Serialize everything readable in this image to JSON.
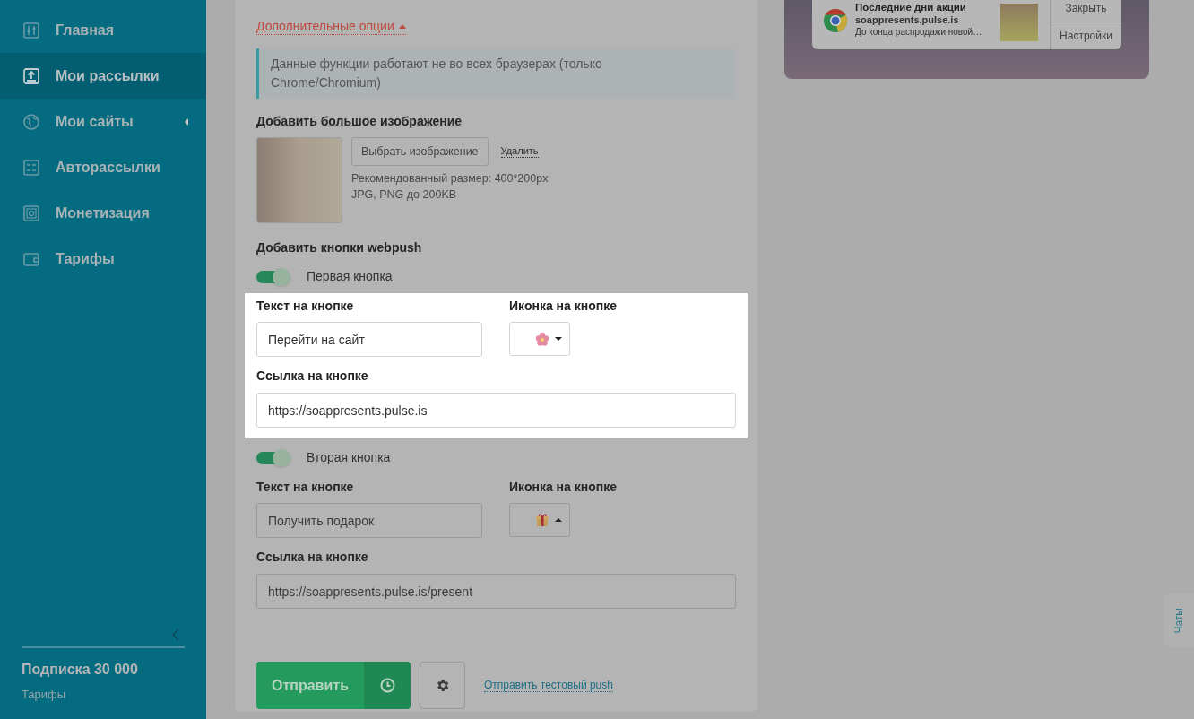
{
  "sidebar": {
    "items": [
      {
        "label": "Главная",
        "selected": false,
        "has_submenu": false,
        "kind": "sliders"
      },
      {
        "label": "Мои рассылки",
        "selected": true,
        "has_submenu": false,
        "kind": "upload"
      },
      {
        "label": "Мои сайты",
        "selected": false,
        "has_submenu": true,
        "kind": "globe"
      },
      {
        "label": "Авторассылки",
        "selected": false,
        "has_submenu": false,
        "kind": "flow"
      },
      {
        "label": "Монетизация",
        "selected": false,
        "has_submenu": false,
        "kind": "safe"
      },
      {
        "label": "Тарифы",
        "selected": false,
        "has_submenu": false,
        "kind": "wallet"
      }
    ],
    "plan": "Подписка 30 000",
    "plan_link": "Тарифы"
  },
  "form": {
    "options_toggle": "Дополнительные опции",
    "options_expanded": true,
    "notice": "Данные функции работают не во всех браузерах (только Chrome/Chromium)",
    "big_image": {
      "heading": "Добавить большое изображение",
      "choose_button": "Выбрать изображение",
      "delete_link": "Удалить",
      "hints": [
        "Рекомендованный размер: 400*200px",
        "JPG, PNG до 200KB"
      ]
    },
    "webpush_heading": "Добавить кнопки webpush",
    "push_buttons": [
      {
        "toggle_label": "Первая кнопка",
        "on": true,
        "highlighted": true,
        "text_label": "Текст на кнопке",
        "text_value": "Перейти на сайт",
        "icon_label": "Иконка на кнопке",
        "kind": "flower",
        "dropdown_open": false,
        "link_label": "Ссылка на кнопке",
        "link_value": "https://soappresents.pulse.is"
      },
      {
        "toggle_label": "Вторая кнопка",
        "on": true,
        "highlighted": false,
        "text_label": "Текст на кнопке",
        "text_value": "Получить подарок",
        "icon_label": "Иконка на кнопке",
        "kind": "gift",
        "dropdown_open": true,
        "link_label": "Ссылка на кнопке",
        "link_value": "https://soappresents.pulse.is/present"
      }
    ],
    "send_button": "Отправить",
    "test_link": "Отправить тестовый push"
  },
  "preview": {
    "title": "Последние дни акции",
    "site": "soappresents.pulse.is",
    "body": "До конца распродажи новой…",
    "buttons": [
      "Закрыть",
      "Настройки"
    ]
  },
  "chat_tab": "Чаты"
}
